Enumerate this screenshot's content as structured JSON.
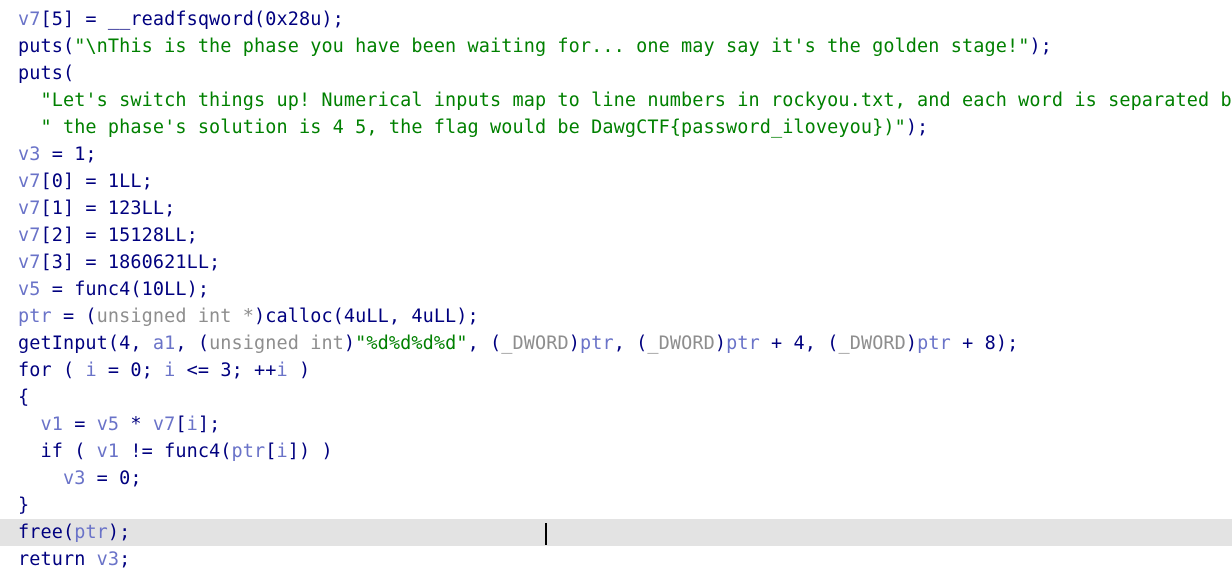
{
  "lines": [
    {
      "tokens": [
        {
          "t": "v7",
          "c": "var"
        },
        {
          "t": "[5] = __readfsqword(0x28u);",
          "c": "op"
        }
      ]
    },
    {
      "tokens": [
        {
          "t": "puts(",
          "c": "op"
        },
        {
          "t": "\"\\nThis is the phase you have been waiting for... one may say it's the golden stage!\"",
          "c": "str"
        },
        {
          "t": ");",
          "c": "op"
        }
      ]
    },
    {
      "tokens": [
        {
          "t": "puts(",
          "c": "op"
        }
      ]
    },
    {
      "tokens": [
        {
          "t": "  ",
          "c": "op"
        },
        {
          "t": "\"Let's switch things up! Numerical inputs map to line numbers in rockyou.txt, and each word is separated by a '_' (if",
          "c": "str"
        }
      ]
    },
    {
      "tokens": [
        {
          "t": "  ",
          "c": "op"
        },
        {
          "t": "\" the phase's solution is 4 5, the flag would be DawgCTF{password_iloveyou})\"",
          "c": "str"
        },
        {
          "t": ");",
          "c": "op"
        }
      ]
    },
    {
      "tokens": [
        {
          "t": "v3",
          "c": "var"
        },
        {
          "t": " = 1;",
          "c": "op"
        }
      ]
    },
    {
      "tokens": [
        {
          "t": "v7",
          "c": "var"
        },
        {
          "t": "[0] = 1LL;",
          "c": "op"
        }
      ]
    },
    {
      "tokens": [
        {
          "t": "v7",
          "c": "var"
        },
        {
          "t": "[1] = 123LL;",
          "c": "op"
        }
      ]
    },
    {
      "tokens": [
        {
          "t": "v7",
          "c": "var"
        },
        {
          "t": "[2] = 15128LL;",
          "c": "op"
        }
      ]
    },
    {
      "tokens": [
        {
          "t": "v7",
          "c": "var"
        },
        {
          "t": "[3] = 1860621LL;",
          "c": "op"
        }
      ]
    },
    {
      "tokens": [
        {
          "t": "v5",
          "c": "var"
        },
        {
          "t": " = func4(10LL);",
          "c": "op"
        }
      ]
    },
    {
      "tokens": [
        {
          "t": "ptr",
          "c": "var"
        },
        {
          "t": " = (",
          "c": "op"
        },
        {
          "t": "unsigned int *",
          "c": "typ"
        },
        {
          "t": ")calloc(4uLL, 4uLL);",
          "c": "op"
        }
      ]
    },
    {
      "tokens": [
        {
          "t": "getInput(4, ",
          "c": "op"
        },
        {
          "t": "a1",
          "c": "var"
        },
        {
          "t": ", (",
          "c": "op"
        },
        {
          "t": "unsigned int",
          "c": "typ"
        },
        {
          "t": ")",
          "c": "op"
        },
        {
          "t": "\"%d%d%d%d\"",
          "c": "str"
        },
        {
          "t": ", (",
          "c": "op"
        },
        {
          "t": "_DWORD",
          "c": "typ"
        },
        {
          "t": ")",
          "c": "op"
        },
        {
          "t": "ptr",
          "c": "var"
        },
        {
          "t": ", (",
          "c": "op"
        },
        {
          "t": "_DWORD",
          "c": "typ"
        },
        {
          "t": ")",
          "c": "op"
        },
        {
          "t": "ptr",
          "c": "var"
        },
        {
          "t": " + 4, (",
          "c": "op"
        },
        {
          "t": "_DWORD",
          "c": "typ"
        },
        {
          "t": ")",
          "c": "op"
        },
        {
          "t": "ptr",
          "c": "var"
        },
        {
          "t": " + 8);",
          "c": "op"
        }
      ]
    },
    {
      "tokens": [
        {
          "t": "for ( ",
          "c": "op"
        },
        {
          "t": "i",
          "c": "var"
        },
        {
          "t": " = 0; ",
          "c": "op"
        },
        {
          "t": "i",
          "c": "var"
        },
        {
          "t": " <= 3; ++",
          "c": "op"
        },
        {
          "t": "i",
          "c": "var"
        },
        {
          "t": " )",
          "c": "op"
        }
      ]
    },
    {
      "tokens": [
        {
          "t": "{",
          "c": "op"
        }
      ]
    },
    {
      "tokens": [
        {
          "t": "  ",
          "c": "op"
        },
        {
          "t": "v1",
          "c": "var"
        },
        {
          "t": " = ",
          "c": "op"
        },
        {
          "t": "v5",
          "c": "var"
        },
        {
          "t": " * ",
          "c": "op"
        },
        {
          "t": "v7",
          "c": "var"
        },
        {
          "t": "[",
          "c": "op"
        },
        {
          "t": "i",
          "c": "var"
        },
        {
          "t": "];",
          "c": "op"
        }
      ]
    },
    {
      "tokens": [
        {
          "t": "  if ( ",
          "c": "op"
        },
        {
          "t": "v1",
          "c": "var"
        },
        {
          "t": " != func4(",
          "c": "op"
        },
        {
          "t": "ptr",
          "c": "var"
        },
        {
          "t": "[",
          "c": "op"
        },
        {
          "t": "i",
          "c": "var"
        },
        {
          "t": "]) )",
          "c": "op"
        }
      ]
    },
    {
      "tokens": [
        {
          "t": "    ",
          "c": "op"
        },
        {
          "t": "v3",
          "c": "var"
        },
        {
          "t": " = 0;",
          "c": "op"
        }
      ]
    },
    {
      "tokens": [
        {
          "t": "}",
          "c": "op"
        }
      ]
    },
    {
      "highlight": true,
      "tokens": [
        {
          "t": "free(",
          "c": "op"
        },
        {
          "t": "ptr",
          "c": "var"
        },
        {
          "t": ");",
          "c": "op"
        }
      ]
    },
    {
      "tokens": [
        {
          "t": "return ",
          "c": "op"
        },
        {
          "t": "v3",
          "c": "var"
        },
        {
          "t": ";",
          "c": "op"
        }
      ]
    }
  ]
}
